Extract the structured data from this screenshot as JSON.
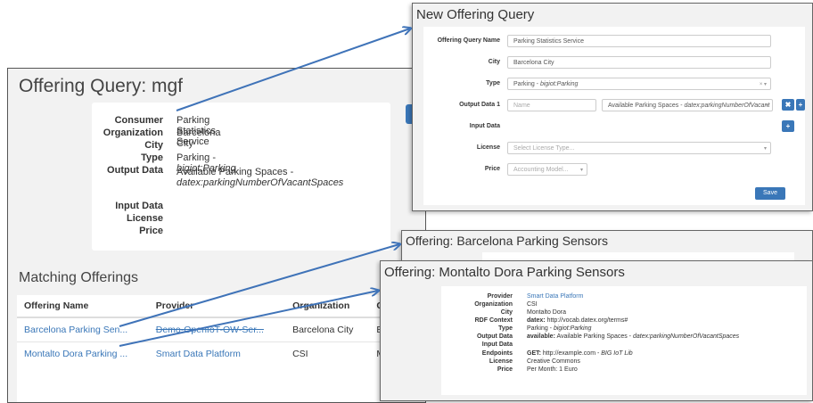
{
  "offering_query": {
    "title": "Offering Query: mgf",
    "details": {
      "consumer_label": "Consumer",
      "consumer_value": "Parking Statistics Service",
      "organization_label": "Organization",
      "organization_value": "Barcelona City",
      "city_label": "City",
      "type_label": "Type",
      "type_value": "Parking - ",
      "type_value_italic": "bigiot:Parking",
      "output_label": "Output Data",
      "output_value": "Available Parking Spaces -",
      "output_value_italic": "datex:parkingNumberOfVacantSpaces",
      "input_label": "Input Data",
      "license_label": "License",
      "price_label": "Price"
    },
    "matching_title": "Matching Offerings",
    "table": {
      "headers": [
        "Offering Name",
        "Provider",
        "Organization",
        "City"
      ],
      "rows": [
        [
          "Barcelona Parking Sen...",
          "Demo-OpenIoT-OW-Ser...",
          "Barcelona City",
          "Barcelona"
        ],
        [
          "Montalto Dora Parking ...",
          "Smart Data Platform",
          "CSI",
          "Montalto D"
        ]
      ]
    }
  },
  "new_offering_query": {
    "title": "New Offering Query",
    "fields": {
      "name_label": "Offering Query Name",
      "name_value": "Parking Statistics Service",
      "city_label": "City",
      "city_value": "Barcelona City",
      "type_label": "Type",
      "type_value": "Parking - ",
      "type_value_italic": "bigiot:Parking",
      "type_clear": "× ▾",
      "output_label": "Output Data 1",
      "output_name_placeholder": "Name",
      "output_value": "Available Parking Spaces - ",
      "output_value_italic": "datex:parkingNumberOfVacant",
      "output_caret": "▾",
      "input_label": "Input Data",
      "license_label": "License",
      "license_placeholder": "Select License Type...",
      "price_label": "Price",
      "price_placeholder": "Accounting Model...",
      "remove_glyph": "✖",
      "add_glyph": "+",
      "save_label": "Save"
    }
  },
  "barcelona_panel": {
    "title": "Offering: Barcelona Parking Sensors"
  },
  "montalto_panel": {
    "title": "Offering: Montalto Dora Parking Sensors",
    "provider_label": "Provider",
    "provider_value": "Smart Data Platform",
    "organization_label": "Organization",
    "organization_value": "CSI",
    "city_label": "City",
    "city_value": "Montalto Dora",
    "rdf_label": "RDF Context",
    "rdf_value_bold": "datex:",
    "rdf_value": " http://vocab.datex.org/terms#",
    "type_label": "Type",
    "type_value": "Parking - ",
    "type_value_italic": "bigiot:Parking",
    "output_label": "Output Data",
    "output_value_bold": "available:",
    "output_value": " Available Parking Spaces - ",
    "output_value_italic": "datex:parkingNumberOfVacantSpaces",
    "input_label": "Input Data",
    "endpoints_label": "Endpoints",
    "endpoints_value_bold": "GET:",
    "endpoints_value": " http://example.com - ",
    "endpoints_value_italic": "BIG IoT Lib",
    "license_label": "License",
    "license_value": "Creative Commons",
    "price_label": "Price",
    "price_value": "Per Month: 1 Euro"
  },
  "colors": {
    "link": "#3a77b8",
    "arrow": "#3f73b8",
    "panel_bg": "#f2f2f2"
  }
}
